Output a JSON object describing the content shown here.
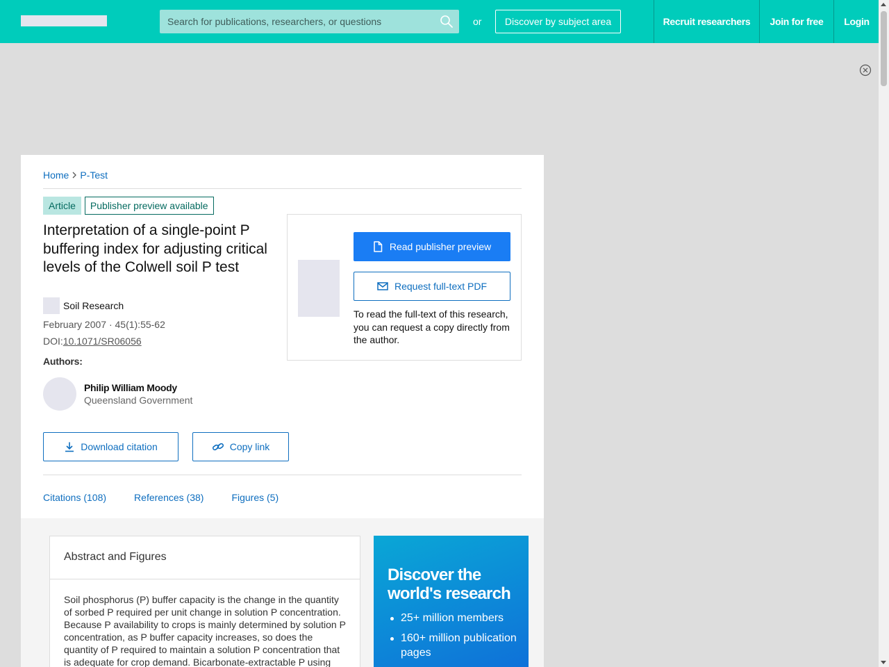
{
  "header": {
    "search_placeholder": "Search for publications, researchers, or questions",
    "or_text": "or",
    "discover_label": "Discover by subject area",
    "nav": {
      "recruit": "Recruit researchers",
      "join": "Join for free",
      "login": "Login"
    }
  },
  "breadcrumb": {
    "home": "Home",
    "current": "P-Test"
  },
  "badges": {
    "type": "Article",
    "preview": "Publisher preview available"
  },
  "publication": {
    "title": "Interpretation of a single-point P buffering index for adjusting critical levels of the Colwell soil P test",
    "journal": "Soil Research",
    "meta": "February 2007 · 45(1):55-62",
    "doi_label": "DOI:",
    "doi": "10.1071/SR06056"
  },
  "authors": {
    "label": "Authors:",
    "list": [
      {
        "name": "Philip William Moody",
        "institution": "Queensland Government"
      }
    ]
  },
  "actions": {
    "download_citation": "Download citation",
    "copy_link": "Copy link"
  },
  "preview": {
    "read_label": "Read publisher preview",
    "request_label": "Request full-text PDF",
    "note": "To read the full-text of this research, you can request a copy directly from the author."
  },
  "tabs": {
    "citations": "Citations (108)",
    "references": "References (38)",
    "figures": "Figures (5)"
  },
  "abstract": {
    "title": "Abstract and Figures",
    "text": "Soil phosphorus (P) buffer capacity is the change in the quantity of sorbed P required per unit change in solution P concentration. Because P availability to crops is mainly determined by solution P concentration, as P buffer capacity increases, so does the quantity of P required to maintain a solution P concentration that is adequate for crop demand. Bicarbonate-extractable P using"
  },
  "promo": {
    "title": "Discover the world's research",
    "items": [
      "25+ million members",
      "160+ million publication pages"
    ]
  },
  "colors": {
    "brand": "#00ccbb",
    "link": "#0e6ebf",
    "primary_button": "#1a7df4"
  }
}
